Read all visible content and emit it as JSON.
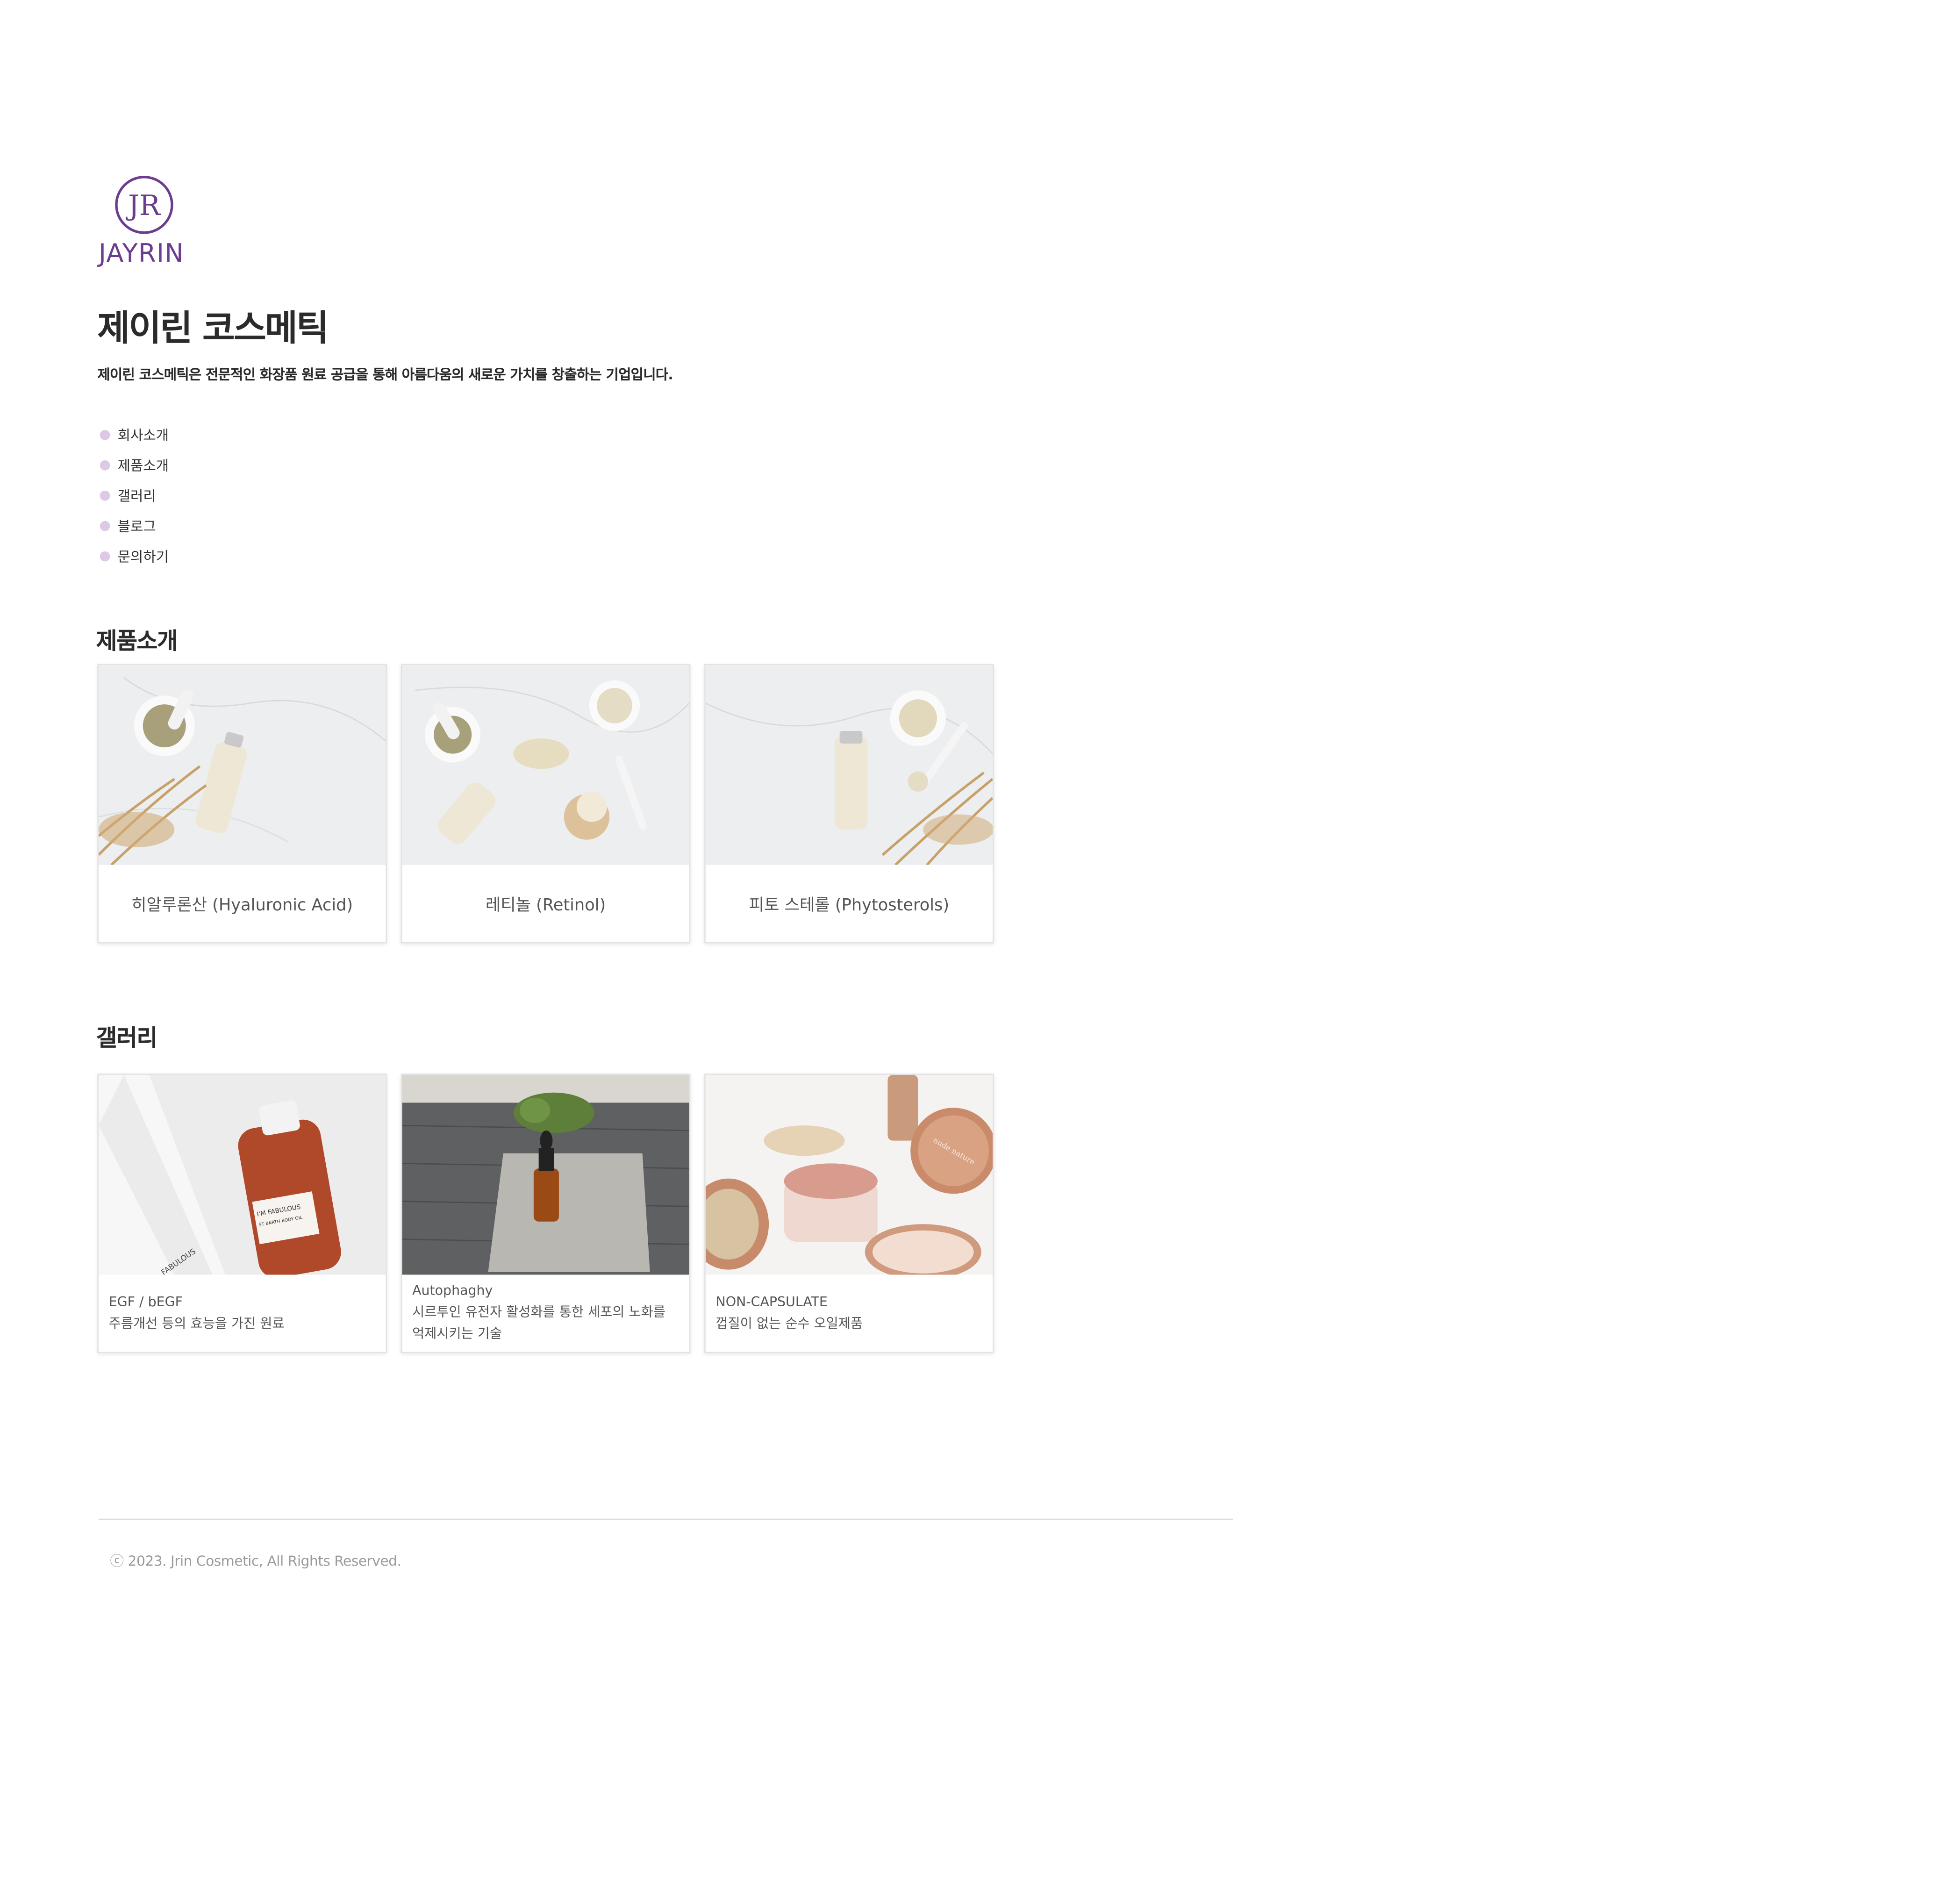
{
  "brand": {
    "logo_monogram": "JR",
    "logo_text": "JAYRIN",
    "accent_color": "#6b3d8f"
  },
  "header": {
    "title": "제이린 코스메틱",
    "intro": "제이린 코스메틱은 전문적인 화장품 원료 공급을 통해 아름다움의 새로운 가치를 창출하는 기업입니다."
  },
  "nav": {
    "items": [
      {
        "label": "회사소개"
      },
      {
        "label": "제품소개"
      },
      {
        "label": "갤러리"
      },
      {
        "label": "블로그"
      },
      {
        "label": "문의하기"
      }
    ]
  },
  "products": {
    "heading": "제품소개",
    "items": [
      {
        "label": "히알루론산 (Hyaluronic Acid)"
      },
      {
        "label": "레티놀 (Retinol)"
      },
      {
        "label": "피토 스테롤 (Phytosterols)"
      }
    ]
  },
  "gallery": {
    "heading": "갤러리",
    "items": [
      {
        "title": "EGF / bEGF",
        "description": "주름개선 등의 효능을 가진 원료",
        "bottle_label_line1": "I'M FABULOUS",
        "bottle_label_line2": "ST BARTH BODY OIL",
        "box_text": "FABULOUS"
      },
      {
        "title": "Autophaghy",
        "description": "시르투인 유전자 활성화를 통한 세포의 노화를 억제시키는 기술"
      },
      {
        "title": "NON-CAPSULATE",
        "description": "껍질이 없는 순수 오일제품",
        "jar_lid_text": "nude nature"
      }
    ]
  },
  "footer": {
    "copyright": "ⓒ 2023. Jrin Cosmetic, All Rights Reserved."
  }
}
